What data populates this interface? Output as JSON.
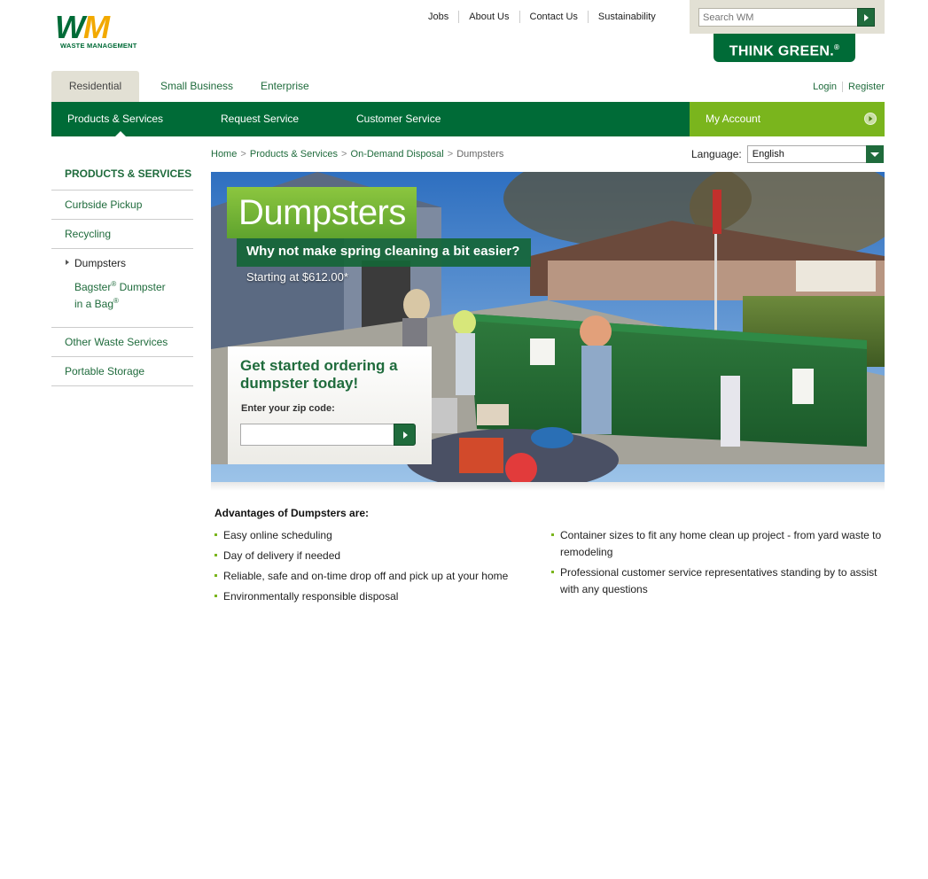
{
  "brand": {
    "logo_letters_w": "W",
    "logo_letters_m": "M",
    "logo_sub": "WASTE MANAGEMENT",
    "think_green": "THINK GREEN.",
    "think_green_mark": "®"
  },
  "top_links": [
    "Jobs",
    "About Us",
    "Contact Us",
    "Sustainability"
  ],
  "search": {
    "placeholder": "Search WM"
  },
  "segment_tabs": [
    "Residential",
    "Small Business",
    "Enterprise"
  ],
  "account_links": {
    "login": "Login",
    "register": "Register"
  },
  "main_nav": {
    "products": "Products & Services",
    "request": "Request Service",
    "customer": "Customer Service",
    "my_account": "My Account"
  },
  "sidebar": {
    "heading": "PRODUCTS & SERVICES",
    "items": [
      "Curbside Pickup",
      "Recycling",
      "Dumpsters",
      "Other Waste Services",
      "Portable Storage"
    ],
    "sub_item_1": "Bagster",
    "sub_item_reg": "®",
    "sub_item_2": " Dumpster",
    "sub_item_3": "in a Bag"
  },
  "breadcrumb": {
    "home": "Home",
    "products": "Products & Services",
    "ondemand": "On-Demand Disposal",
    "current": "Dumpsters",
    "sep": ">"
  },
  "language": {
    "label": "Language:",
    "selected": "English"
  },
  "hero": {
    "title": "Dumpsters",
    "subtitle": "Why not make spring cleaning a bit easier?",
    "price": "Starting at $612.00*",
    "order_title": "Get started ordering a dumpster today!",
    "zip_label": "Enter your zip code:",
    "zip_value": ""
  },
  "advantages": {
    "title": "Advantages of Dumpsters are:",
    "left": [
      "Easy online scheduling",
      "Day of delivery if needed",
      "Reliable, safe and on-time drop off and pick up at your home",
      "Environmentally responsible disposal"
    ],
    "right": [
      "Container sizes to fit any home clean up project - from yard waste to remodeling",
      "Professional customer service representatives standing by to assist with any questions"
    ]
  }
}
